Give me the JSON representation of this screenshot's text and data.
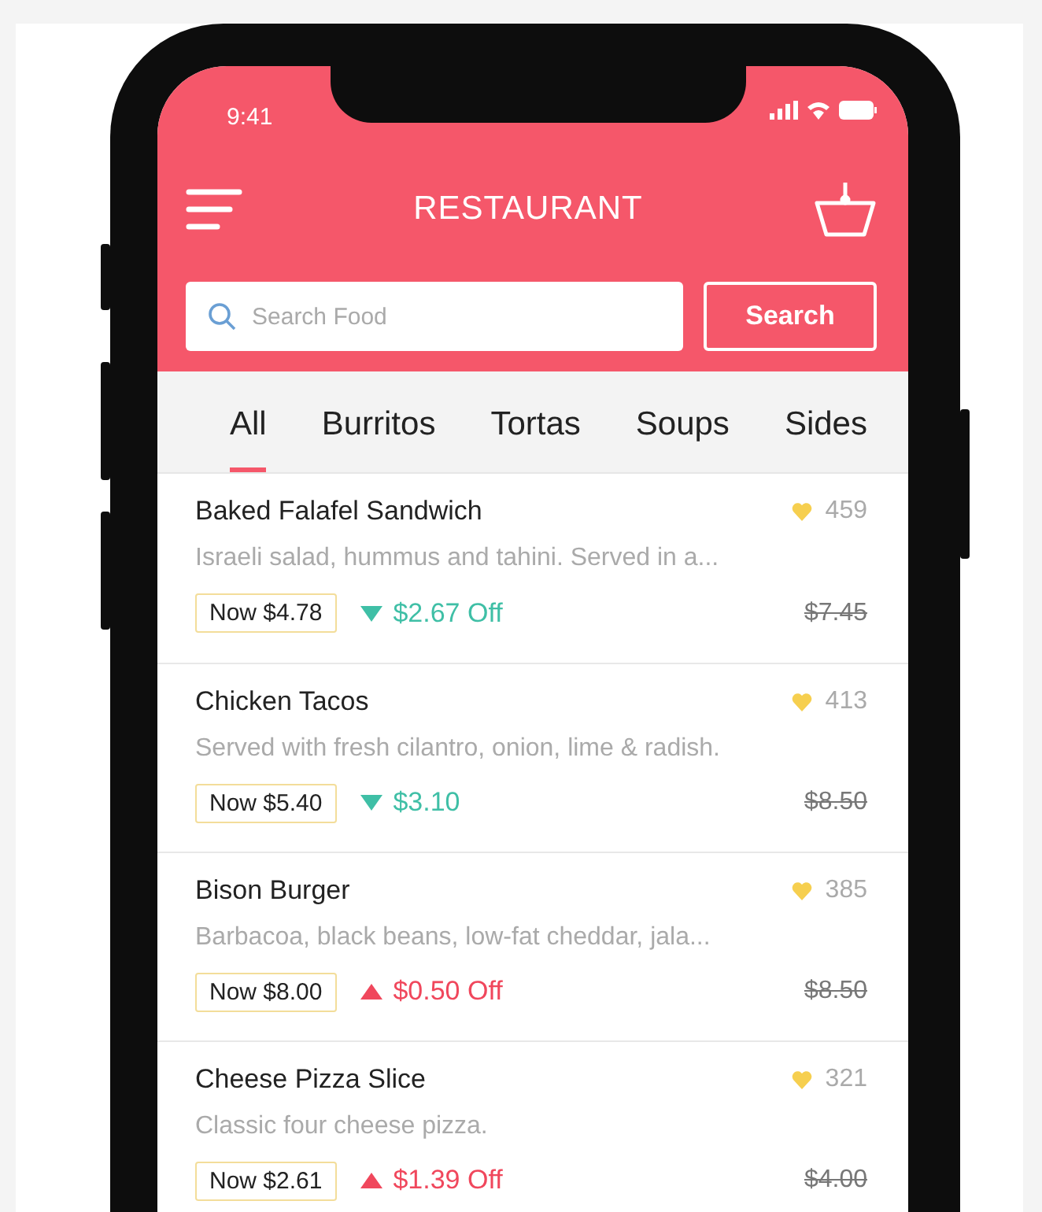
{
  "status_bar": {
    "time": "9:41"
  },
  "header": {
    "title": "RESTAURANT"
  },
  "search": {
    "placeholder": "Search Food",
    "button": "Search"
  },
  "tabs": [
    {
      "label": "All",
      "selected": true
    },
    {
      "label": "Burritos",
      "selected": false
    },
    {
      "label": "Tortas",
      "selected": false
    },
    {
      "label": "Soups",
      "selected": false
    },
    {
      "label": "Sides",
      "selected": false
    }
  ],
  "items": [
    {
      "name": "Baked Falafel Sandwich",
      "likes": "459",
      "description": "Israeli salad, hummus and tahini. Served in a...",
      "now": "Now $4.78",
      "kind": "down",
      "discount": "$2.67 Off",
      "old_price": "$7.45"
    },
    {
      "name": "Chicken Tacos",
      "likes": "413",
      "description": "Served with fresh cilantro, onion, lime & radish.",
      "now": "Now $5.40",
      "kind": "down",
      "discount": "$3.10",
      "old_price": "$8.50"
    },
    {
      "name": "Bison Burger",
      "likes": "385",
      "description": "Barbacoa, black beans, low-fat cheddar, jala...",
      "now": "Now $8.00",
      "kind": "up",
      "discount": "$0.50 Off",
      "old_price": "$8.50"
    },
    {
      "name": "Cheese Pizza Slice",
      "likes": "321",
      "description": "Classic four cheese pizza.",
      "now": "Now $2.61",
      "kind": "up",
      "discount": "$1.39 Off",
      "old_price": "$4.00"
    }
  ]
}
